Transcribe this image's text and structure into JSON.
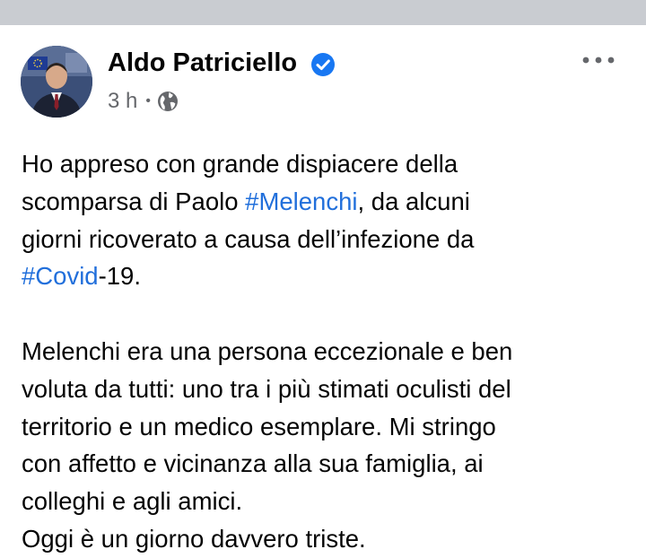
{
  "post": {
    "author": "Aldo Patriciello",
    "verified": true,
    "timestamp": "3 h",
    "separator": "•",
    "audience_icon": "globe-icon",
    "more_icon": "more-options-icon",
    "body": {
      "p1_line1": "Ho appreso con grande dispiacere della",
      "p1_line2_pre": "scomparsa di Paolo ",
      "p1_hashtag1": "#Melenchi",
      "p1_line2_post": ", da alcuni",
      "p1_line3": "giorni ricoverato a causa dell’infezione da",
      "p1_hashtag2": "#Covid",
      "p1_line4_post": "-19.",
      "p2_line1": "Melenchi era una persona eccezionale e ben",
      "p2_line2": "voluta da tutti: uno tra i più stimati oculisti del",
      "p2_line3": "territorio e un medico esemplare. Mi stringo",
      "p2_line4": "con affetto e vicinanza alla sua famiglia, ai",
      "p2_line5": "colleghi e agli amici.",
      "p2_line6": "Oggi è un giorno davvero triste."
    }
  },
  "colors": {
    "hashtag": "#216fdb",
    "verified_badge": "#1877f2",
    "meta_text": "#65676b",
    "divider": "#c9ccd1"
  }
}
